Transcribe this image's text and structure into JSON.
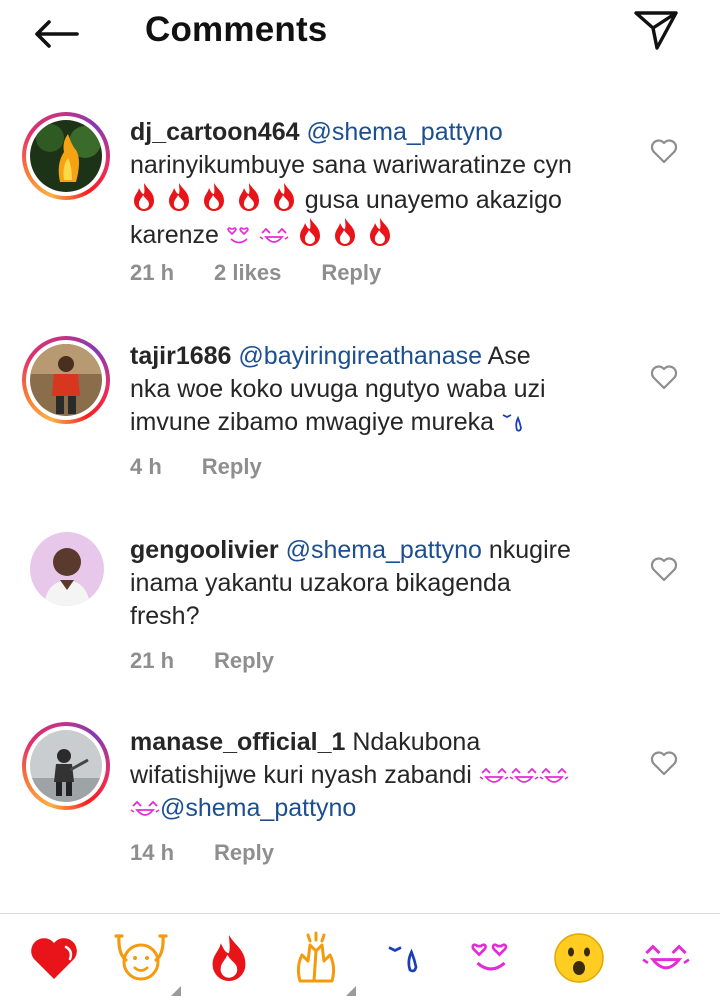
{
  "header": {
    "title": "Comments"
  },
  "comments": [
    {
      "username": "dj_cartoon464",
      "mention": "@shema_pattyno",
      "text_line1": "narinyikumbuye sana wariwaratinze cyn",
      "text_line2": " gusa unayemo akazigo",
      "text_line3": "karenze",
      "time": "21 h",
      "likes": "2 likes",
      "reply": "Reply"
    },
    {
      "username": "tajir1686",
      "mention": "@bayiringireathanase",
      "text_after_mention": " Ase",
      "text_line2": "nka woe koko uvuga ngutyo waba uzi",
      "text_line3": "imvune zibamo mwagiye mureka",
      "time": "4 h",
      "reply": "Reply"
    },
    {
      "username": "gengoolivier",
      "mention": "@shema_pattyno",
      "text_after_mention": " nkugire",
      "text_line2": "inama yakantu uzakora bikagenda",
      "text_line3": "fresh?",
      "time": "21 h",
      "reply": "Reply"
    },
    {
      "username": "manase_official_1",
      "text_after_user": " Ndakubona",
      "text_line2": "wifatishijwe kuri nyash zabandi",
      "mention": "@shema_pattyno",
      "time": "14 h",
      "reply": "Reply"
    }
  ],
  "reaction_bar": [
    "heart",
    "raising-hands",
    "fire",
    "clapping-hands",
    "crying-face",
    "heart-eyes",
    "laughing-face",
    "surprised-face",
    "tears-of-joy"
  ],
  "colors": {
    "mention": "#1b4f8f",
    "meta": "#8e8e8e",
    "fire": "#e8141a",
    "heart": "#e8141a"
  }
}
